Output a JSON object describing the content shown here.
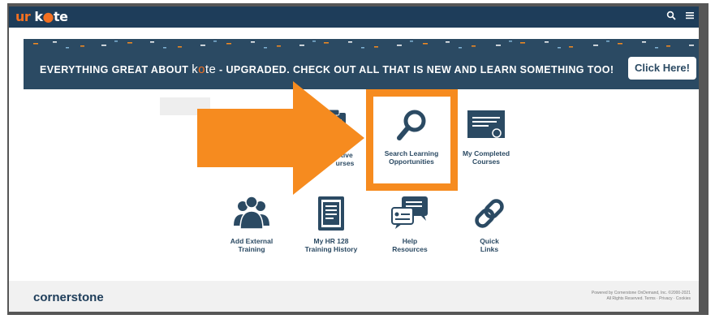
{
  "header": {
    "logo_ur": "ur",
    "logo_k": "k",
    "logo_a": "●",
    "logo_te": "te",
    "icons": [
      "search-icon",
      "menu-icon"
    ]
  },
  "banner": {
    "text_before": "EVERYTHING GREAT ABOUT ",
    "kate_k": "k",
    "kate_a": "o",
    "kate_te": "te",
    "text_after": " - UPGRADED. CHECK OUT ALL THAT IS NEW AND LEARN SOMETHING TOO!",
    "button_label": "Click Here!"
  },
  "tiles": {
    "active_courses": {
      "label_line1": "ctive",
      "label_line2": "urses",
      "icon": "clipboard-icon"
    },
    "search_learning": {
      "label_line1": "Search Learning",
      "label_line2": "Opportunities",
      "icon": "magnifier-icon"
    },
    "completed_courses": {
      "label_line1": "My Completed",
      "label_line2": "Courses",
      "icon": "certificate-icon"
    },
    "add_external": {
      "label_line1": "Add External",
      "label_line2": "Training",
      "icon": "people-icon"
    },
    "hr128": {
      "label_line1": "My HR 128",
      "label_line2": "Training History",
      "icon": "document-icon"
    },
    "help_resources": {
      "label_line1": "Help",
      "label_line2": "Resources",
      "icon": "chat-icon"
    },
    "quick_links": {
      "label_line1": "Quick",
      "label_line2": "Links",
      "icon": "chain-link-icon"
    }
  },
  "footer": {
    "brand": "cornerstone",
    "legal_line1": "Powered by Cornerstone OnDemand, Inc. ©2000-2021",
    "legal_line2": "All Rights Reserved. Terms · Privacy · Cookies"
  },
  "colors": {
    "navy": "#1e3d5a",
    "banner": "#2b4a63",
    "orange": "#f68b1f",
    "brand_orange": "#f37021"
  }
}
